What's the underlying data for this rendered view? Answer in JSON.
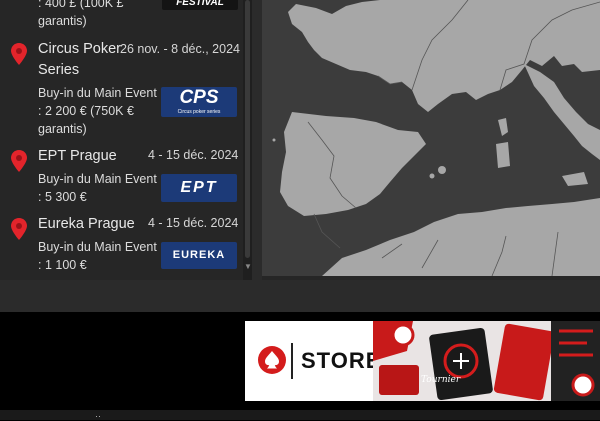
{
  "events": [
    {
      "id": "prev",
      "buyin_tail": ": 400 £ (100K £ garantis)",
      "logo_text": "FESTIVAL"
    },
    {
      "id": "circus",
      "name": "Circus Poker Series",
      "dates": "26 nov. - 8 déc., 2024",
      "buyin": "Buy-in du Main Event : 2 200 € (750K € garantis)",
      "logo_text": "CPS",
      "logo_sub": "Circus poker series"
    },
    {
      "id": "ept",
      "name": "EPT Prague",
      "dates": "4 - 15 déc. 2024",
      "buyin": "Buy-in du Main Event : 5 300 €",
      "logo_text": "EPT"
    },
    {
      "id": "eureka",
      "name": "Eureka Prague",
      "dates": "4 - 15 déc. 2024",
      "buyin": "Buy-in du Main Event : 1 100 €",
      "logo_text": "EUREKA"
    }
  ],
  "ad": {
    "store_label": "STORE",
    "product_label": "Tournier"
  },
  "colors": {
    "pin": "#e3242b",
    "badge": "#1c3a78",
    "ad_red": "#d41c1c"
  },
  "icons": {
    "pin": "map-pin-icon",
    "spade": "spade-icon",
    "scroll": "chevron-down-icon"
  }
}
